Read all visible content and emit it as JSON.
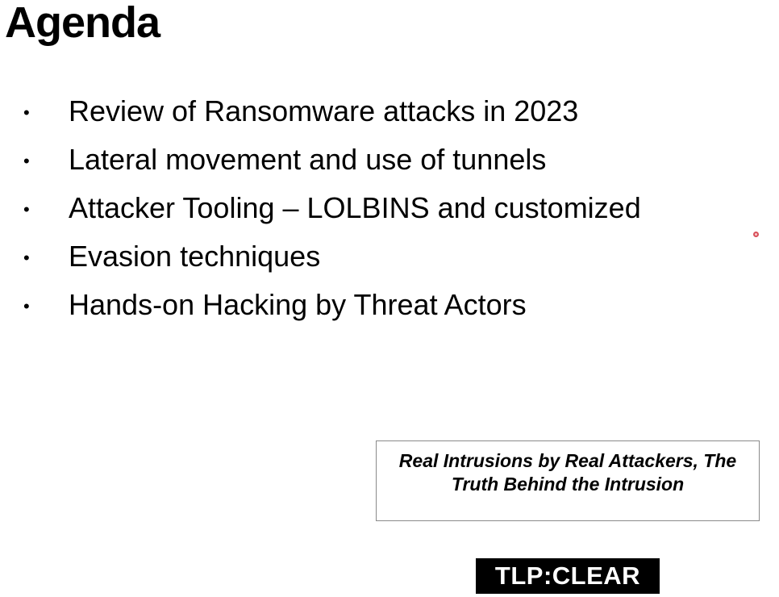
{
  "slide": {
    "title": "Agenda",
    "bullet_symbol": "•",
    "items": [
      "Review of Ransomware attacks in 2023",
      "Lateral movement and use of tunnels",
      "Attacker Tooling – LOLBINS and customized",
      "Evasion techniques",
      "Hands-on Hacking by Threat Actors"
    ],
    "subtitle_lines": [
      "Real Intrusions by Real Attackers, The",
      "Truth Behind the Intrusion"
    ],
    "badge": "TLP:CLEAR"
  },
  "colors": {
    "background": "#ffffff",
    "text": "#000000",
    "badge_background": "#000000",
    "badge_text": "#ffffff",
    "pointer": "#d8505a"
  }
}
